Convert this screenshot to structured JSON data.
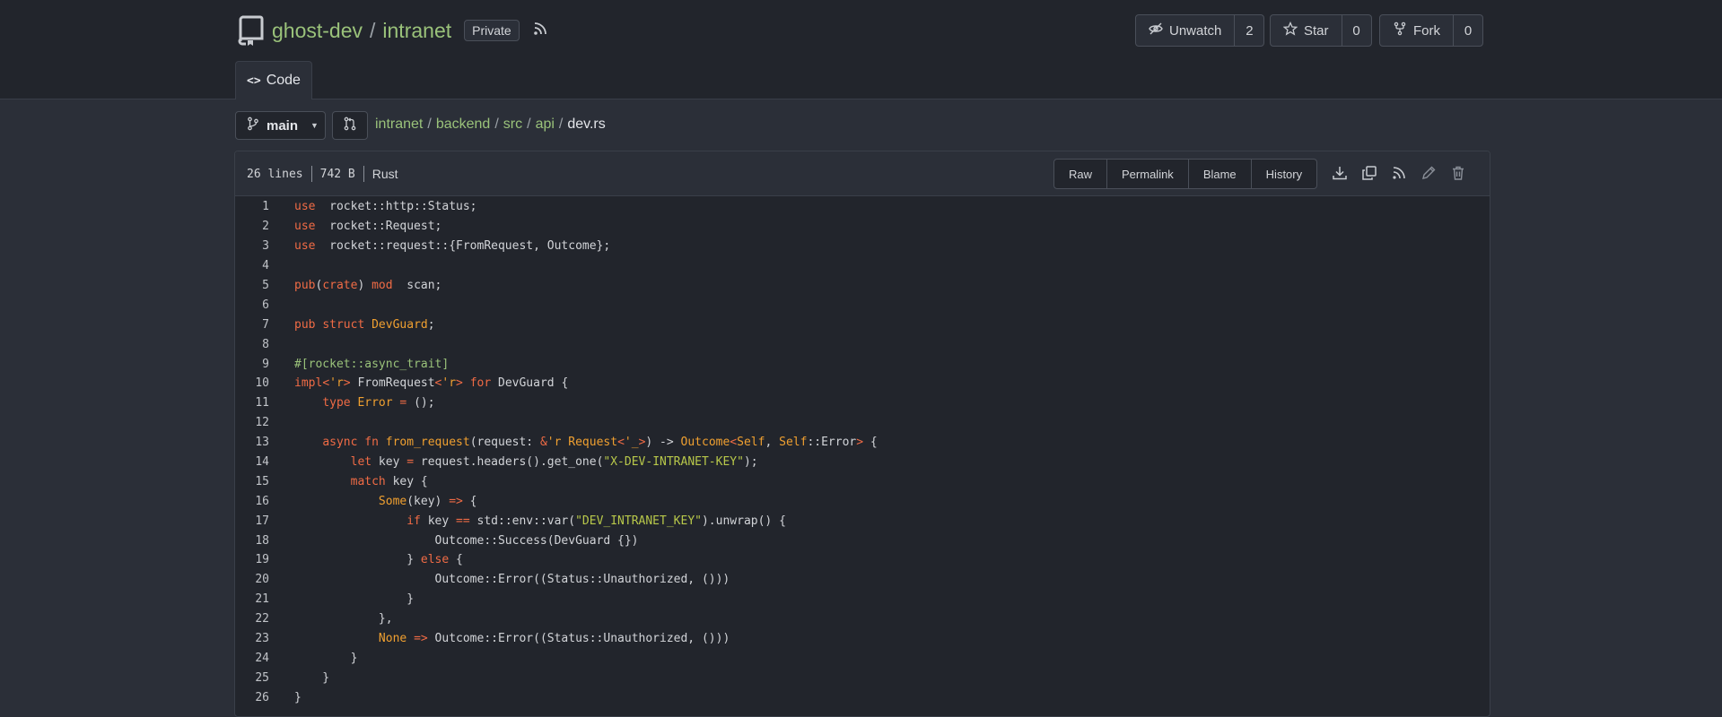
{
  "repo": {
    "owner": "ghost-dev",
    "separator": "/",
    "name": "intranet",
    "visibility": "Private"
  },
  "actions": {
    "unwatch": {
      "label": "Unwatch",
      "count": "2"
    },
    "star": {
      "label": "Star",
      "count": "0"
    },
    "fork": {
      "label": "Fork",
      "count": "0"
    }
  },
  "tabs": [
    {
      "label": "Code",
      "active": true
    }
  ],
  "branch": {
    "name": "main"
  },
  "breadcrumb": {
    "items": [
      "intranet",
      "backend",
      "src",
      "api"
    ],
    "current": "dev.rs",
    "separator": "/"
  },
  "file": {
    "lines_label": "26 lines",
    "size_label": "742 B",
    "language": "Rust",
    "buttons": [
      "Raw",
      "Permalink",
      "Blame",
      "History"
    ],
    "icons": [
      "download-icon",
      "copy-icon",
      "rss-icon",
      "edit-icon",
      "trash-icon"
    ]
  },
  "colors": {
    "accent_link": "#9ac27a",
    "keyword": "#f06b45",
    "type": "#f0a030",
    "string": "#b8c84a",
    "background": "#2b2f38"
  },
  "code_lines": [
    [
      [
        "kw",
        "use"
      ],
      [
        "",
        "  rocket::http::Status;"
      ]
    ],
    [
      [
        "kw",
        "use"
      ],
      [
        "",
        "  rocket::Request;"
      ]
    ],
    [
      [
        "kw",
        "use"
      ],
      [
        "",
        "  rocket::request::{FromRequest, Outcome};"
      ]
    ],
    [],
    [
      [
        "kw",
        "pub"
      ],
      [
        "",
        "("
      ],
      [
        "kw",
        "crate"
      ],
      [
        "",
        ") "
      ],
      [
        "kw",
        "mod"
      ],
      [
        "",
        "  scan;"
      ]
    ],
    [],
    [
      [
        "kw",
        "pub"
      ],
      [
        "",
        " "
      ],
      [
        "kw",
        "struct"
      ],
      [
        "",
        " "
      ],
      [
        "ty",
        "DevGuard"
      ],
      [
        "",
        ";"
      ]
    ],
    [],
    [
      [
        "at",
        "#[rocket::async_trait]"
      ]
    ],
    [
      [
        "kw",
        "impl"
      ],
      [
        "op",
        "<"
      ],
      [
        "ty",
        "'r"
      ],
      [
        "op",
        ">"
      ],
      [
        "",
        " FromRequest"
      ],
      [
        "op",
        "<"
      ],
      [
        "ty",
        "'r"
      ],
      [
        "op",
        ">"
      ],
      [
        "",
        " "
      ],
      [
        "kw",
        "for"
      ],
      [
        "",
        " DevGuard {"
      ]
    ],
    [
      [
        "",
        "    "
      ],
      [
        "kw",
        "type"
      ],
      [
        "",
        " "
      ],
      [
        "ty",
        "Error"
      ],
      [
        "",
        " "
      ],
      [
        "op",
        "="
      ],
      [
        "",
        " ();"
      ]
    ],
    [],
    [
      [
        "",
        "    "
      ],
      [
        "kw",
        "async"
      ],
      [
        "",
        " "
      ],
      [
        "kw",
        "fn"
      ],
      [
        "",
        " "
      ],
      [
        "ty",
        "from_request"
      ],
      [
        "",
        "(request: "
      ],
      [
        "op",
        "&"
      ],
      [
        "ty",
        "'r"
      ],
      [
        "",
        " "
      ],
      [
        "ty",
        "Request"
      ],
      [
        "op",
        "<"
      ],
      [
        "ty",
        "'_"
      ],
      [
        "op",
        ">"
      ],
      [
        "",
        ") -> "
      ],
      [
        "ty",
        "Outcome"
      ],
      [
        "op",
        "<"
      ],
      [
        "ty",
        "Self"
      ],
      [
        "",
        ", "
      ],
      [
        "ty",
        "Self"
      ],
      [
        "",
        "::Error"
      ],
      [
        "op",
        ">"
      ],
      [
        "",
        " {"
      ]
    ],
    [
      [
        "",
        "        "
      ],
      [
        "kw",
        "let"
      ],
      [
        "",
        " key "
      ],
      [
        "op",
        "="
      ],
      [
        "",
        " request.headers().get_one("
      ],
      [
        "st",
        "\"X-DEV-INTRANET-KEY\""
      ],
      [
        "",
        ");"
      ]
    ],
    [
      [
        "",
        "        "
      ],
      [
        "kw",
        "match"
      ],
      [
        "",
        " key {"
      ]
    ],
    [
      [
        "",
        "            "
      ],
      [
        "ty",
        "Some"
      ],
      [
        "",
        "(key) "
      ],
      [
        "op",
        "=>"
      ],
      [
        "",
        " {"
      ]
    ],
    [
      [
        "",
        "                "
      ],
      [
        "kw",
        "if"
      ],
      [
        "",
        " key "
      ],
      [
        "op",
        "=="
      ],
      [
        "",
        " std::env::var("
      ],
      [
        "st",
        "\"DEV_INTRANET_KEY\""
      ],
      [
        "",
        ").unwrap() {"
      ]
    ],
    [
      [
        "",
        "                    Outcome::Success(DevGuard {})"
      ]
    ],
    [
      [
        "",
        "                } "
      ],
      [
        "kw",
        "else"
      ],
      [
        "",
        " {"
      ]
    ],
    [
      [
        "",
        "                    Outcome::Error((Status::Unauthorized, ()))"
      ]
    ],
    [
      [
        "",
        "                }"
      ]
    ],
    [
      [
        "",
        "            },"
      ]
    ],
    [
      [
        "",
        "            "
      ],
      [
        "ty",
        "None"
      ],
      [
        "",
        " "
      ],
      [
        "op",
        "=>"
      ],
      [
        "",
        " Outcome::Error((Status::Unauthorized, ()))"
      ]
    ],
    [
      [
        "",
        "        }"
      ]
    ],
    [
      [
        "",
        "    }"
      ]
    ],
    [
      [
        "",
        "}"
      ]
    ]
  ]
}
